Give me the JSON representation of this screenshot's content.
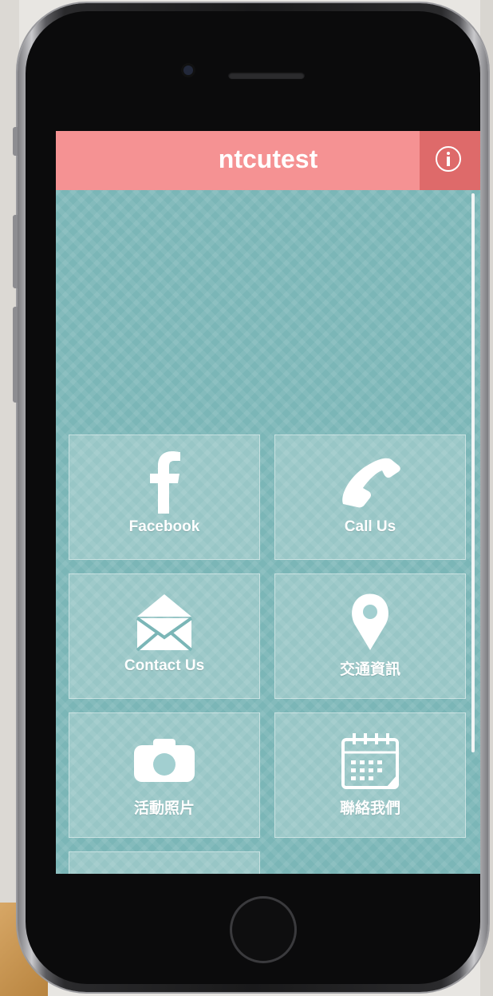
{
  "app": {
    "title": "ntcutest"
  },
  "header": {
    "info_icon": "info-icon"
  },
  "tiles": [
    {
      "label": "Facebook",
      "icon": "facebook-icon"
    },
    {
      "label": "Call Us",
      "icon": "phone-icon"
    },
    {
      "label": "Contact Us",
      "icon": "envelope-icon"
    },
    {
      "label": "交通資訊",
      "icon": "map-pin-icon"
    },
    {
      "label": "活動照片",
      "icon": "camera-icon"
    },
    {
      "label": "聯絡我們",
      "icon": "calendar-icon"
    },
    {
      "label": "",
      "icon": ""
    }
  ],
  "colors": {
    "header": "#f59293",
    "info_button": "#de6a6a",
    "background": "#7bb6b7"
  }
}
